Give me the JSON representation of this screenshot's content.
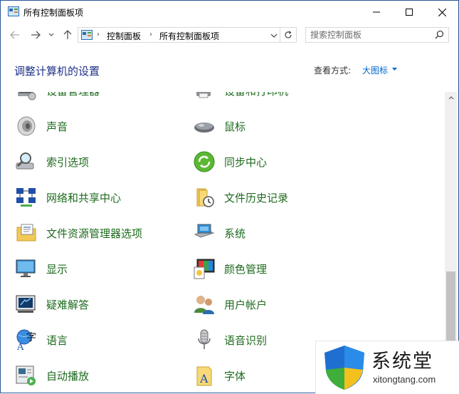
{
  "window": {
    "title": "所有控制面板项"
  },
  "nav": {
    "breadcrumb": [
      "控制面板",
      "所有控制面板项"
    ],
    "search_placeholder": "搜索控制面板"
  },
  "header": {
    "title": "调整计算机的设置",
    "view_by_label": "查看方式:",
    "view_by_value": "大图标"
  },
  "items": [
    {
      "label": "设备管理器",
      "icon": "device-manager-icon"
    },
    {
      "label": "设备和打印机",
      "icon": "printer-icon"
    },
    {
      "label": "声音",
      "icon": "speaker-icon"
    },
    {
      "label": "鼠标",
      "icon": "mouse-icon"
    },
    {
      "label": "索引选项",
      "icon": "indexing-icon"
    },
    {
      "label": "同步中心",
      "icon": "sync-icon"
    },
    {
      "label": "网络和共享中心",
      "icon": "network-icon"
    },
    {
      "label": "文件历史记录",
      "icon": "file-history-icon"
    },
    {
      "label": "文件资源管理器选项",
      "icon": "folder-options-icon"
    },
    {
      "label": "系统",
      "icon": "system-icon"
    },
    {
      "label": "显示",
      "icon": "display-icon"
    },
    {
      "label": "颜色管理",
      "icon": "color-management-icon"
    },
    {
      "label": "疑难解答",
      "icon": "troubleshooting-icon"
    },
    {
      "label": "用户帐户",
      "icon": "user-accounts-icon"
    },
    {
      "label": "语言",
      "icon": "language-icon"
    },
    {
      "label": "语音识别",
      "icon": "speech-recognition-icon"
    },
    {
      "label": "自动播放",
      "icon": "autoplay-icon"
    },
    {
      "label": "字体",
      "icon": "fonts-icon"
    }
  ],
  "watermark": {
    "brand": "系统堂",
    "site": "xitongtang.com"
  },
  "colors": {
    "link_green": "#1e6a1e",
    "title_blue": "#1e3287",
    "accent_blue": "#0066cc"
  }
}
